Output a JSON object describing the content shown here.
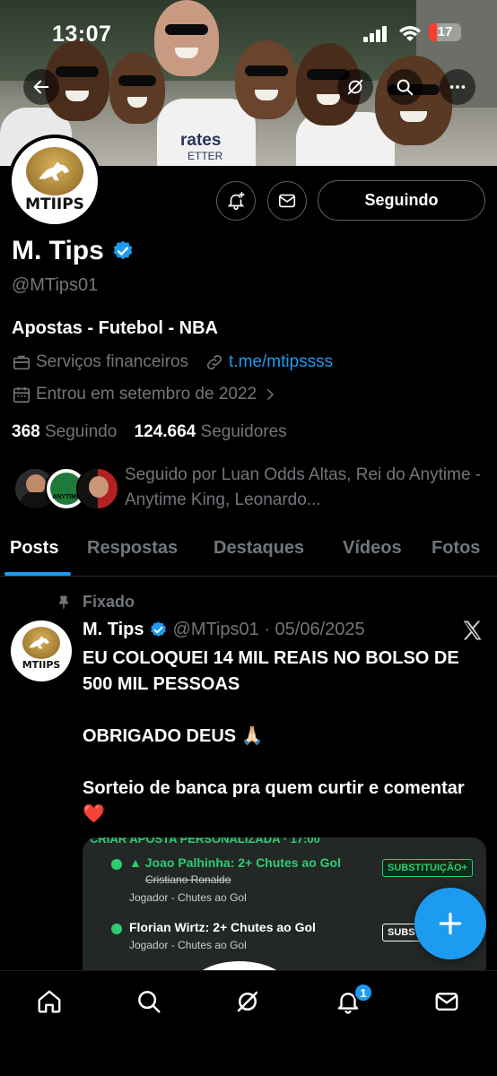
{
  "status_bar": {
    "time": "13:07",
    "battery": "17"
  },
  "banner": {
    "shirt_text": "rates",
    "shirt_subtext": "ETTER"
  },
  "profile": {
    "avatar_text": "MTIIPS",
    "name": "M. Tips",
    "handle": "@MTips01",
    "bio": "Apostas - Futebol - NBA",
    "category": "Serviços financeiros",
    "link": "t.me/mtipssss",
    "joined": "Entrou em setembro de 2022",
    "following_count": "368",
    "following_label": "Seguindo",
    "followers_count": "124.664",
    "followers_label": "Seguidores",
    "followed_by": "Seguido por Luan Odds Altas, Rei do Anytime - Anytime King, Leonardo...",
    "follower_avatar_2_text": "ANYTIME"
  },
  "actions": {
    "follow_label": "Seguindo"
  },
  "tabs": [
    {
      "label": "Posts",
      "active": true
    },
    {
      "label": "Respostas"
    },
    {
      "label": "Destaques"
    },
    {
      "label": "Vídeos"
    },
    {
      "label": "Fotos"
    }
  ],
  "post": {
    "pinned_label": "Fixado",
    "author": "M. Tips",
    "meta": "@MTips01 · 05/06/2025",
    "paragraphs": [
      "EU COLOQUEI 14 MIL REAIS NO BOLSO DE 500 MIL PESSOAS",
      "OBRIGADO DEUS 🙏🏻",
      "Sorteio de banca pra quem curtir e comentar ❤️"
    ],
    "media": {
      "header": "CRIAR APOSTA PERSONALIZADA · 17:00",
      "bet1": "Joao Palhinha: 2+ Chutes ao Gol",
      "bet1_struck": "Cristiano Ronaldo",
      "bet1_sub": "Jogador - Chutes ao Gol",
      "bet1_badge": "SUBSTITUIÇÃO+",
      "bet2": "Florian Wirtz: 2+ Chutes ao Gol",
      "bet2_sub": "Jogador - Chutes ao Gol",
      "bet2_badge": "SUBST"
    }
  },
  "bottom_nav": {
    "notifications_badge": "1"
  },
  "colors": {
    "accent": "#1d9bf0",
    "muted": "#71767b",
    "border": "#536471"
  }
}
